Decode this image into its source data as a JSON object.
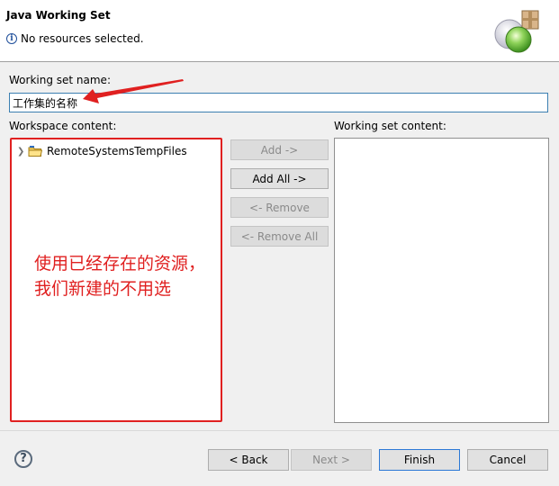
{
  "dialog": {
    "title": "Java Working Set",
    "info_message": "No resources selected."
  },
  "form": {
    "name_label": "Working set name:",
    "name_value": "工作集的名称",
    "workspace_label": "Workspace content:",
    "working_set_label": "Working set content:"
  },
  "workspace_tree": {
    "items": [
      {
        "label": "RemoteSystemsTempFiles",
        "icon": "project-folder-icon",
        "expandable": true
      }
    ]
  },
  "working_set_list": {
    "items": []
  },
  "buttons": {
    "add": "Add ->",
    "add_all": "Add All ->",
    "remove": "<- Remove",
    "remove_all": "<- Remove All",
    "back": "< Back",
    "next": "Next >",
    "finish": "Finish",
    "cancel": "Cancel"
  },
  "annotation": {
    "line1": "使用已经存在的资源，",
    "line2": "我们新建的不用选",
    "color": "#e02020"
  },
  "icons": {
    "info": "info-icon",
    "help": "help-icon",
    "wizard": "working-set-wizard-icon"
  }
}
